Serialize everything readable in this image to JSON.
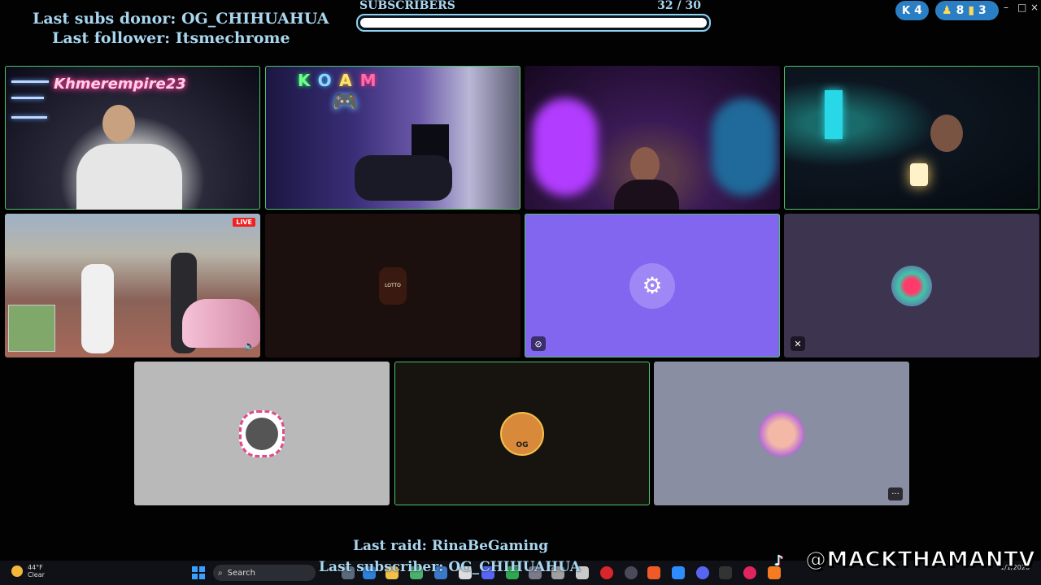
{
  "overlay": {
    "last_donor": "Last subs donor: OG_CHIHUAHUA",
    "last_follower": "Last follower: Itsmechrome",
    "last_raid": "Last raid: RinaBeGaming",
    "last_subscriber": "Last subscriber: OG_CHIHUAHUA",
    "handle": "@MACKTHAMANTV"
  },
  "sub_goal": {
    "label": "SUBSCRIBERS",
    "count": "32  / 30",
    "progress_fraction": 1.0
  },
  "stats": {
    "kick_count": "4",
    "viewers_count": "8",
    "chart_count": "3"
  },
  "window_controls": [
    "–",
    "□",
    "×"
  ],
  "tiles": {
    "khmer_neon_text": "Khmerempire23",
    "neon_letters": [
      "K",
      "O",
      "A",
      "M"
    ],
    "gta_live_badge": "LIVE",
    "lotto_avatar_text": "LOTTO",
    "og_badge": "OG"
  },
  "taskbar": {
    "temperature": "44°F",
    "weather": "Clear",
    "search_placeholder": "Search",
    "date": "1/1/2026"
  },
  "colors": {
    "accent_text": "#a9d6ef",
    "speaking_outline": "#4ec26b",
    "discord_purple": "#8266ef",
    "pill_blue": "#2a7ec4"
  }
}
